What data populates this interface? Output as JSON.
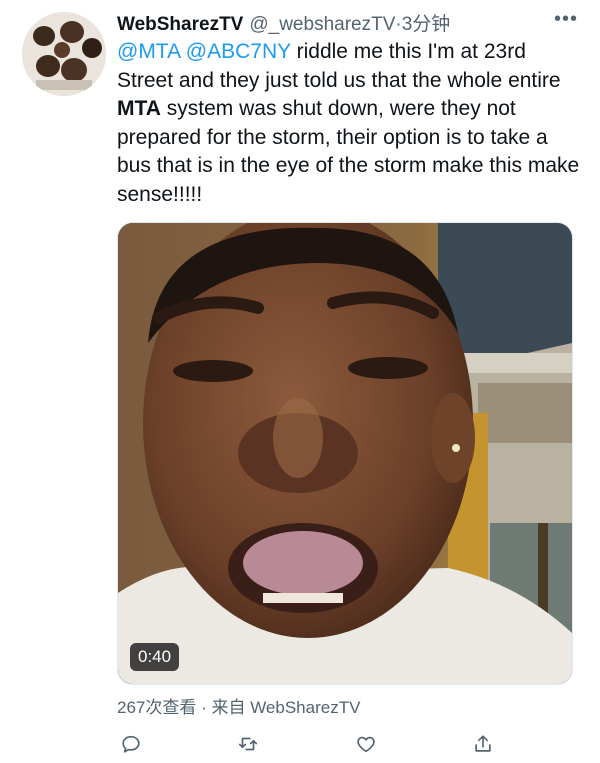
{
  "tweet": {
    "display_name": "WebSharezTV",
    "handle": "@_websharezTV",
    "separator": "·",
    "time": "3分钟",
    "more_label": "•••",
    "text_parts": {
      "mention1": "@MTA",
      "mention2": "@ABC7NY",
      "part1": " riddle me this I'm at 23rd Street and they just told us that the whole entire ",
      "bold": "MTA",
      "part2": " system was shut down, were they not prepared for the storm, their option is to take a bus that is in the eye of the storm make this make sense!!!!!"
    },
    "video": {
      "duration": "0:40"
    },
    "meta": "267次查看 · 来自 WebSharezTV"
  },
  "actions": [
    {
      "name": "reply-icon"
    },
    {
      "name": "retweet-icon"
    },
    {
      "name": "like-icon"
    },
    {
      "name": "share-icon"
    }
  ],
  "colors": {
    "accent": "#1d9bf0",
    "text": "#0f1419",
    "secondary": "#536471"
  }
}
